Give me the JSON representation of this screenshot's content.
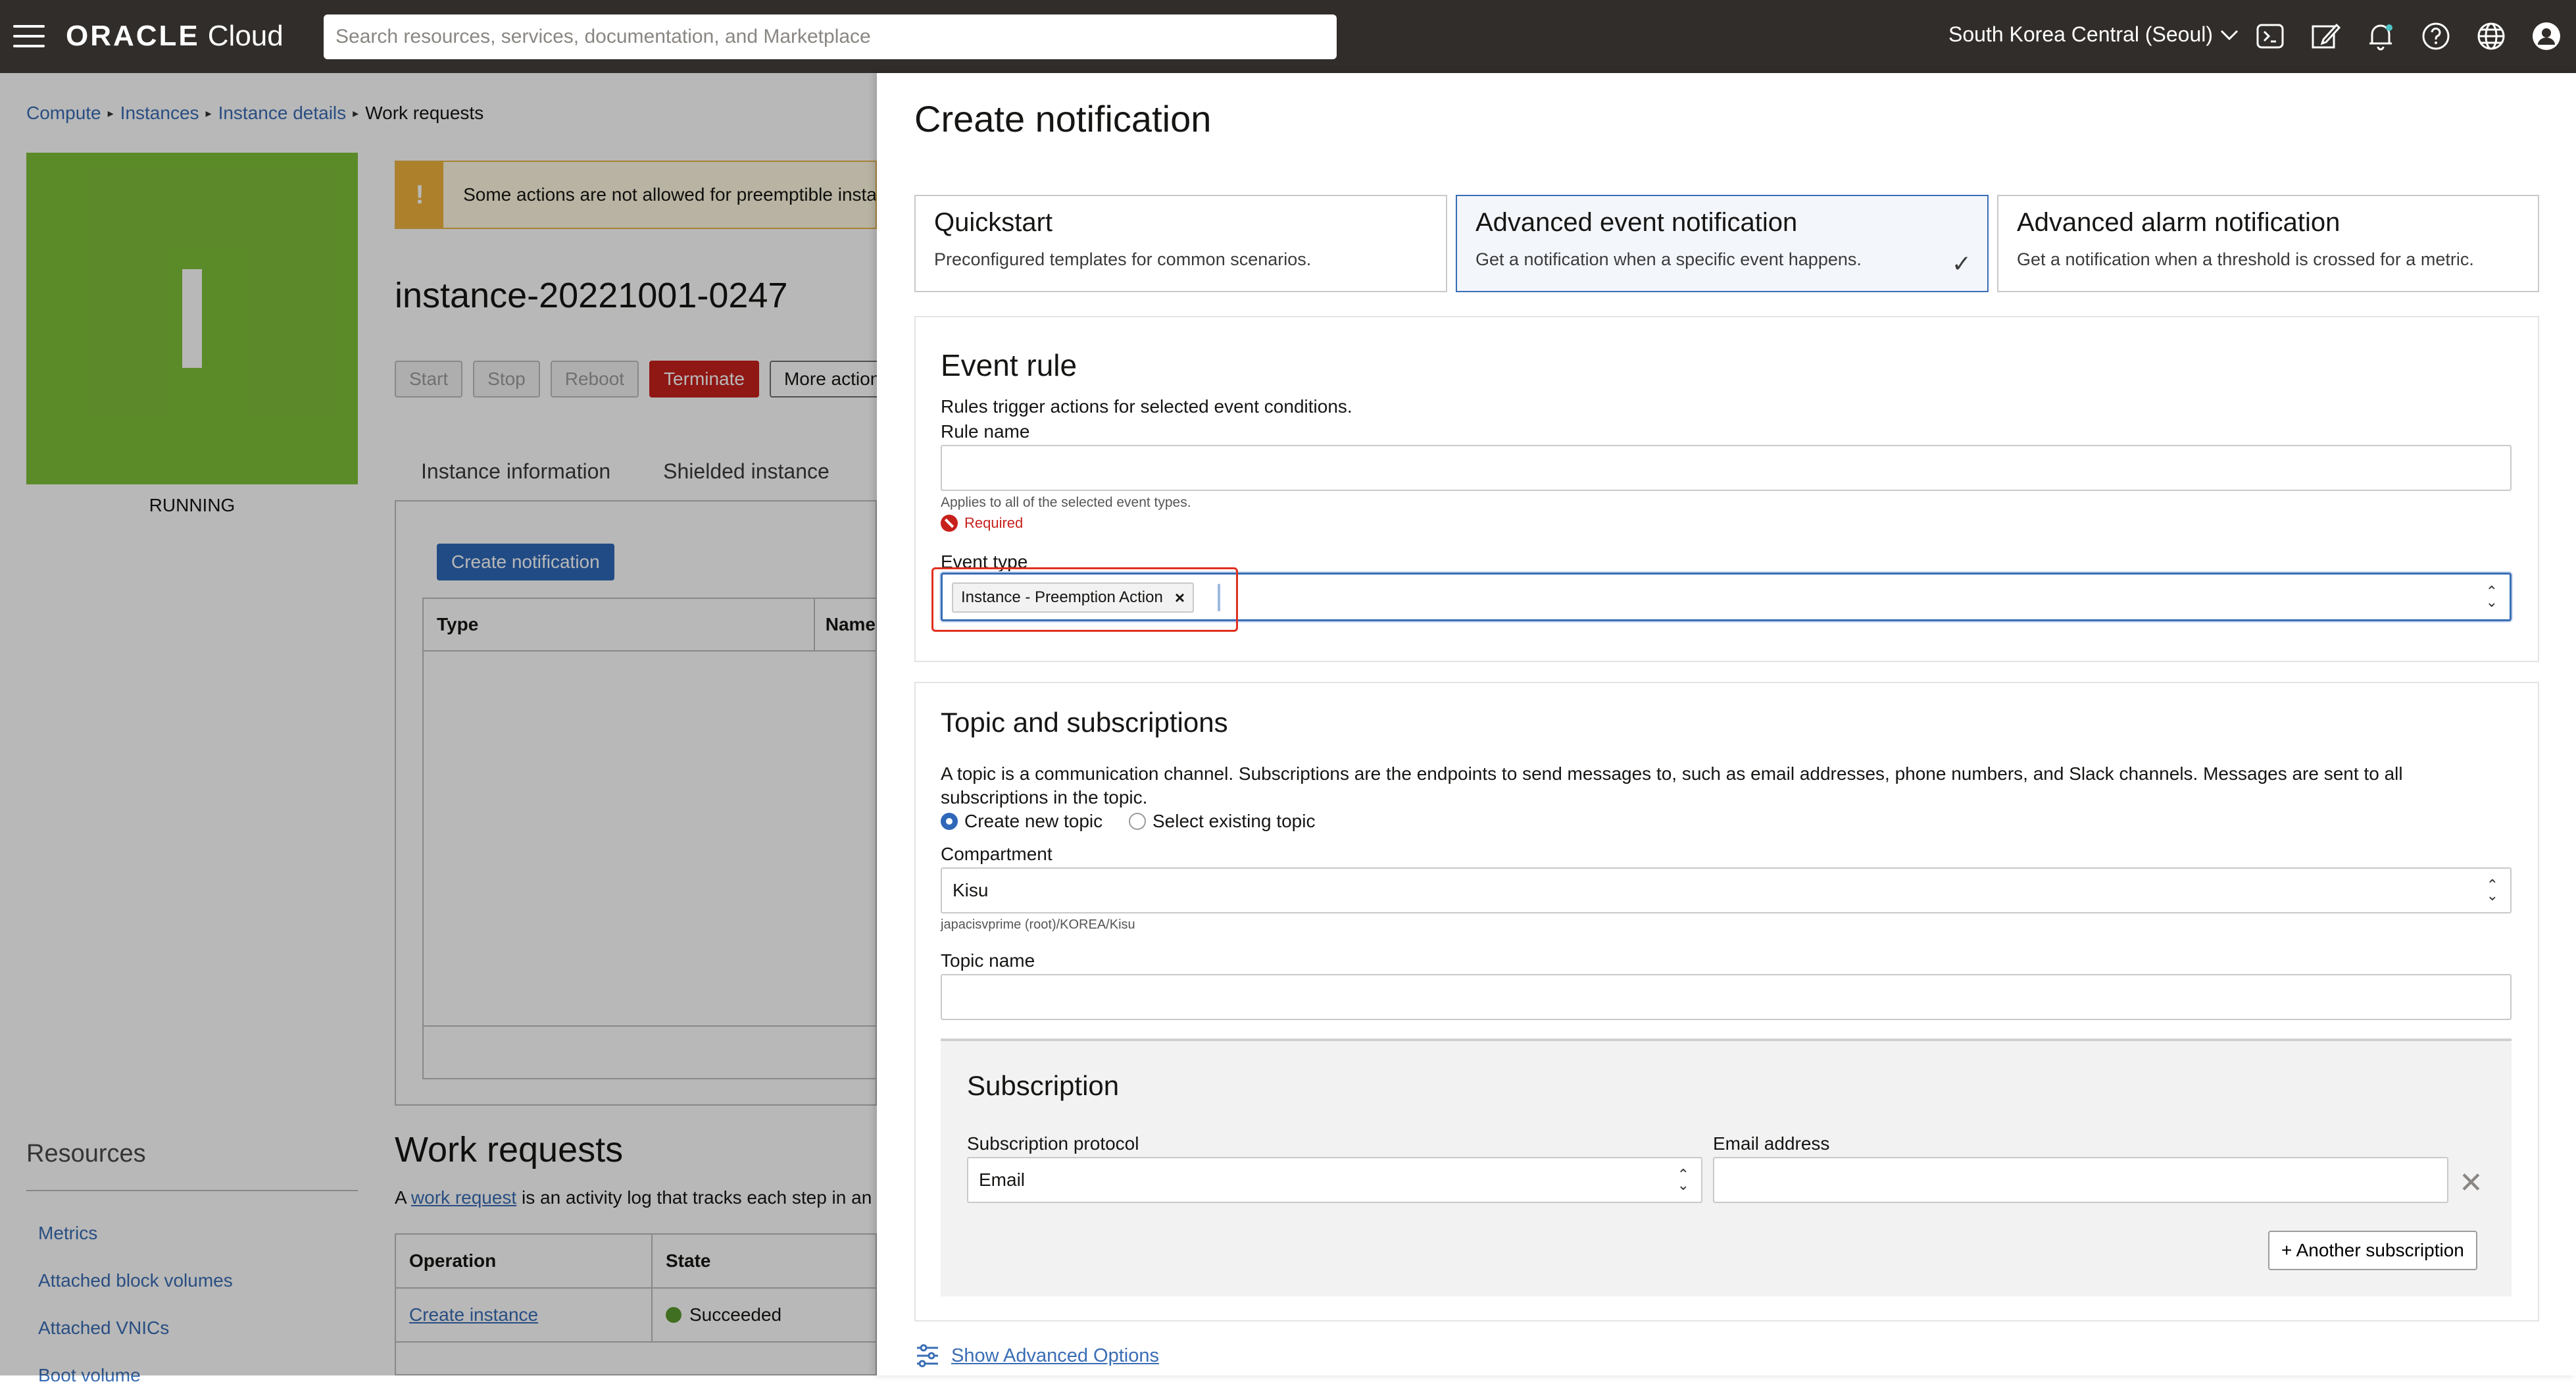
{
  "topbar": {
    "logo_brand": "ORACLE",
    "logo_product": "Cloud",
    "search_placeholder": "Search resources, services, documentation, and Marketplace",
    "region": "South Korea Central (Seoul)",
    "icons": [
      "cloud-shell-icon",
      "edit-icon",
      "bell-icon",
      "help-icon",
      "globe-icon",
      "user-icon"
    ]
  },
  "breadcrumb": [
    "Compute",
    "Instances",
    "Instance details",
    "Work requests"
  ],
  "instance": {
    "status": "RUNNING",
    "warning": "Some actions are not allowed for preemptible instances.",
    "name": "instance-20221001-0247",
    "actions": {
      "start": "Start",
      "stop": "Stop",
      "reboot": "Reboot",
      "terminate": "Terminate",
      "more": "More actions"
    },
    "tabs": [
      "Instance information",
      "Shielded instance"
    ],
    "create_notification_label": "Create notification",
    "table_headers": [
      "Type",
      "Name"
    ]
  },
  "resources": {
    "title": "Resources",
    "links": [
      "Metrics",
      "Attached block volumes",
      "Attached VNICs",
      "Boot volume"
    ]
  },
  "work_requests": {
    "title": "Work requests",
    "desc_prefix": "A ",
    "desc_link": "work request",
    "desc_suffix": " is an activity log that tracks each step in an operation.",
    "headers": [
      "Operation",
      "State"
    ],
    "rows": [
      {
        "operation": "Create instance",
        "state": "Succeeded"
      }
    ]
  },
  "panel": {
    "title": "Create notification",
    "cards": [
      {
        "title": "Quickstart",
        "desc": "Preconfigured templates for common scenarios."
      },
      {
        "title": "Advanced event notification",
        "desc": "Get a notification when a specific event happens."
      },
      {
        "title": "Advanced alarm notification",
        "desc": "Get a notification when a threshold is crossed for a metric."
      }
    ],
    "event_rule": {
      "title": "Event rule",
      "desc": "Rules trigger actions for selected event conditions.",
      "rule_name_label": "Rule name",
      "rule_name_value": "",
      "helper": "Applies to all of the selected event types.",
      "required": "Required",
      "event_type_label": "Event type",
      "event_type_chip": "Instance - Preemption Action"
    },
    "topic": {
      "title": "Topic and subscriptions",
      "desc": "A topic is a communication channel. Subscriptions are the endpoints to send messages to, such as email addresses, phone numbers, and Slack channels. Messages are sent to all subscriptions in the topic.",
      "radio_new": "Create new topic",
      "radio_existing": "Select existing topic",
      "compartment_label": "Compartment",
      "compartment_value": "Kisu",
      "compartment_path": "japacisvprime (root)/KOREA/Kisu",
      "topic_name_label": "Topic name",
      "topic_name_value": ""
    },
    "subscription": {
      "title": "Subscription",
      "protocol_label": "Subscription protocol",
      "protocol_value": "Email",
      "email_label": "Email address",
      "email_value": "",
      "another_label": "+ Another subscription"
    },
    "advanced_link": "Show Advanced Options"
  }
}
